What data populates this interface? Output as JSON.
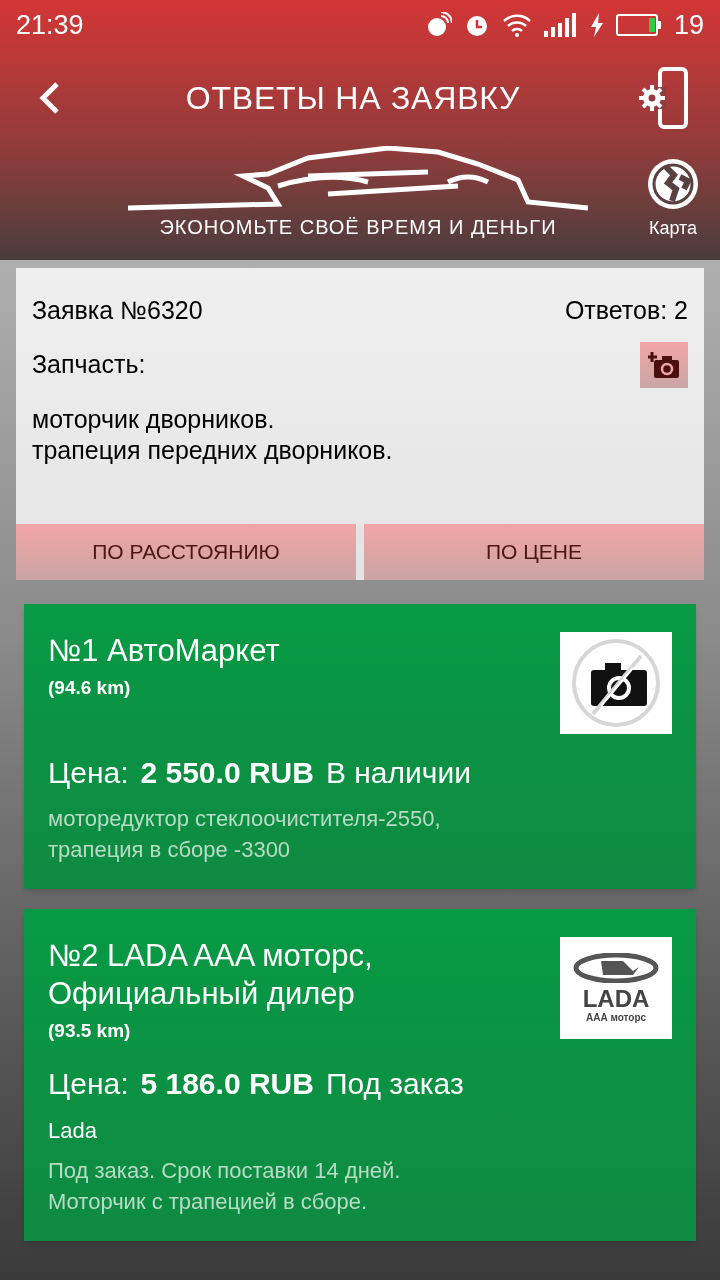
{
  "status_bar": {
    "time": "21:39",
    "battery": "19"
  },
  "header": {
    "title": "ОТВЕТЫ НА ЗАЯВКУ",
    "slogan": "ЭКОНОМЬТЕ СВОЁ ВРЕМЯ И ДЕНЬГИ",
    "map_label": "Карта"
  },
  "request": {
    "number": "Заявка №6320",
    "answers": "Ответов: 2",
    "part_label": "Запчасть:",
    "parts": [
      "моторчик дворников.",
      "трапеция передних дворников."
    ]
  },
  "sort_buttons": [
    "ПО РАССТОЯНИЮ",
    "ПО ЦЕНЕ"
  ],
  "offers": [
    {
      "title": "№1 АвтоМаркет",
      "distance": "(94.6 km)",
      "price_label": "Цена:",
      "price": "2 550.0 RUB",
      "availability": "В наличии",
      "comment": [
        "моторедуктор стеклоочистителя-2550,",
        "трапеция в сборе -3300"
      ],
      "logo": {
        "kind": "none"
      }
    },
    {
      "title": "№2 LADA AAA моторс, Официальный дилер",
      "distance": "(93.5 km)",
      "price_label": "Цена:",
      "price": "5 186.0 RUB",
      "availability": "Под заказ",
      "brand": "Lada",
      "comment": [
        "Под заказ. Срок поставки 14 дней.",
        "Моторчик с трапецией в сборе."
      ],
      "logo": {
        "kind": "brand",
        "title": "LADA",
        "subtitle": "ААА моторс"
      }
    }
  ]
}
